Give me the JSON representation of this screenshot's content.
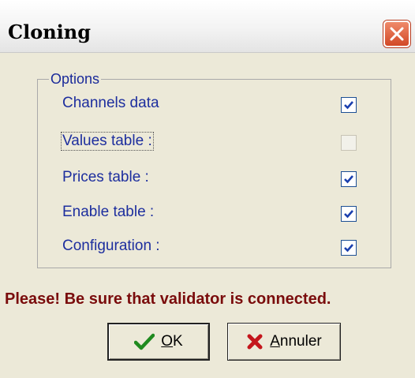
{
  "window": {
    "title": "Cloning"
  },
  "options": {
    "legend": "Options",
    "items": [
      {
        "label": "Channels data",
        "checked": true,
        "enabled": true
      },
      {
        "label": "Values table :",
        "checked": false,
        "enabled": false
      },
      {
        "label": "Prices table :",
        "checked": true,
        "enabled": true
      },
      {
        "label": "Enable table :",
        "checked": true,
        "enabled": true
      },
      {
        "label": "Configuration :",
        "checked": true,
        "enabled": true
      }
    ]
  },
  "warning": "Please! Be sure that validator is connected.",
  "buttons": {
    "ok": {
      "mnemonic": "O",
      "rest": "K",
      "icon": "checkmark-icon"
    },
    "cancel": {
      "mnemonic": "A",
      "rest": "nnuler",
      "icon": "red-x-icon"
    }
  },
  "colors": {
    "accent": "#1d2e9e",
    "warning": "#7a0c0c",
    "close": "#d24826"
  }
}
